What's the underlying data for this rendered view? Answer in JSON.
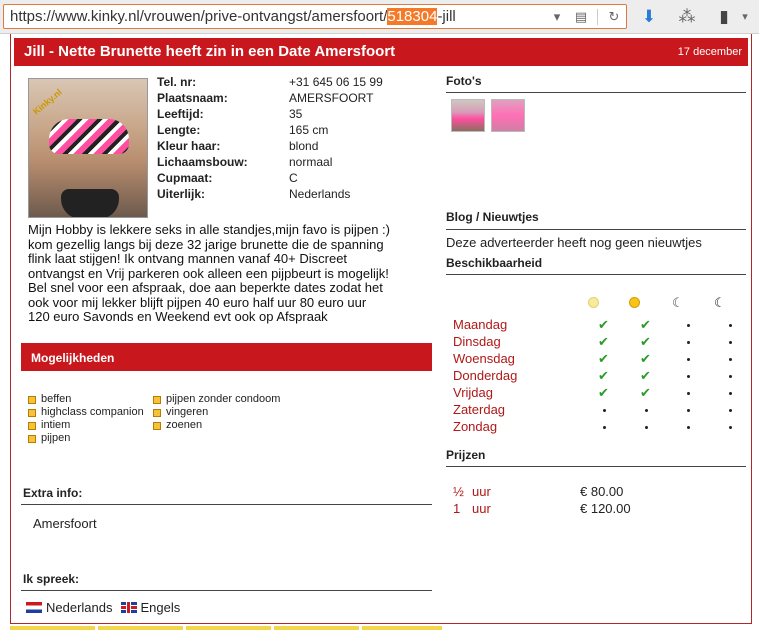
{
  "browser": {
    "url_before": "https://www.kinky.nl/vrouwen/prive-ontvangst/amersfoort/",
    "url_selected": "518304",
    "url_after": "-jill"
  },
  "header": {
    "title": "Jill - Nette Brunette heeft zin in een Date Amersfoort",
    "date": "17 december"
  },
  "photo_logo": "Kinky.nl",
  "profile": [
    {
      "label": "Tel. nr:",
      "value": "+31 645 06 15 99"
    },
    {
      "label": "Plaatsnaam:",
      "value": "AMERSFOORT"
    },
    {
      "label": "Leeftijd:",
      "value": "35"
    },
    {
      "label": "Lengte:",
      "value": "165 cm"
    },
    {
      "label": "Kleur haar:",
      "value": "blond"
    },
    {
      "label": "Lichaamsbouw:",
      "value": "normaal"
    },
    {
      "label": "Cupmaat:",
      "value": "C"
    },
    {
      "label": "Uiterlijk:",
      "value": "Nederlands"
    }
  ],
  "description": "Mijn Hobby is lekkere seks in alle standjes,mijn favo is pijpen :) kom gezellig langs bij deze 32 jarige brunette die de spanning flink laat stijgen! Ik ontvang mannen vanaf 40+ Discreet ontvangst en Vrij parkeren ook alleen een pijpbeurt is mogelijk! Bel snel voor een afspraak, doe aan beperkte dates zodat het ook voor mij lekker blijft pijpen 40 euro half uur 80 euro uur 120 euro Savonds en Weekend evt ook op Afspraak",
  "mogelijkheden": {
    "heading": "Mogelijkheden",
    "col1": [
      "beffen",
      "highclass companion",
      "intiem",
      "pijpen"
    ],
    "col2": [
      "pijpen zonder condoom",
      "vingeren",
      "zoenen"
    ]
  },
  "extra_info": {
    "heading": "Extra info:",
    "value": "Amersfoort"
  },
  "languages": {
    "heading": "Ik spreek:",
    "items": [
      "Nederlands",
      "Engels"
    ]
  },
  "fotos": {
    "heading": "Foto's"
  },
  "blog": {
    "heading": "Blog / Nieuwtjes",
    "text": "Deze adverteerder heeft nog geen nieuwtjes"
  },
  "availability": {
    "heading": "Beschikbaarheid",
    "days": [
      {
        "name": "Maandag",
        "slots": [
          true,
          true,
          false,
          false
        ]
      },
      {
        "name": "Dinsdag",
        "slots": [
          true,
          true,
          false,
          false
        ]
      },
      {
        "name": "Woensdag",
        "slots": [
          true,
          true,
          false,
          false
        ]
      },
      {
        "name": "Donderdag",
        "slots": [
          true,
          true,
          false,
          false
        ]
      },
      {
        "name": "Vrijdag",
        "slots": [
          true,
          true,
          false,
          false
        ]
      },
      {
        "name": "Zaterdag",
        "slots": [
          false,
          false,
          false,
          false
        ]
      },
      {
        "name": "Zondag",
        "slots": [
          false,
          false,
          false,
          false
        ]
      }
    ]
  },
  "prijzen": {
    "heading": "Prijzen",
    "rows": [
      {
        "qty": "½",
        "unit": "uur",
        "price": "€ 80.00"
      },
      {
        "qty": "1",
        "unit": "uur",
        "price": "€ 120.00"
      }
    ]
  },
  "colors": {
    "accent": "#c8181d",
    "day_text": "#b01818",
    "check": "#2a9a2a"
  }
}
